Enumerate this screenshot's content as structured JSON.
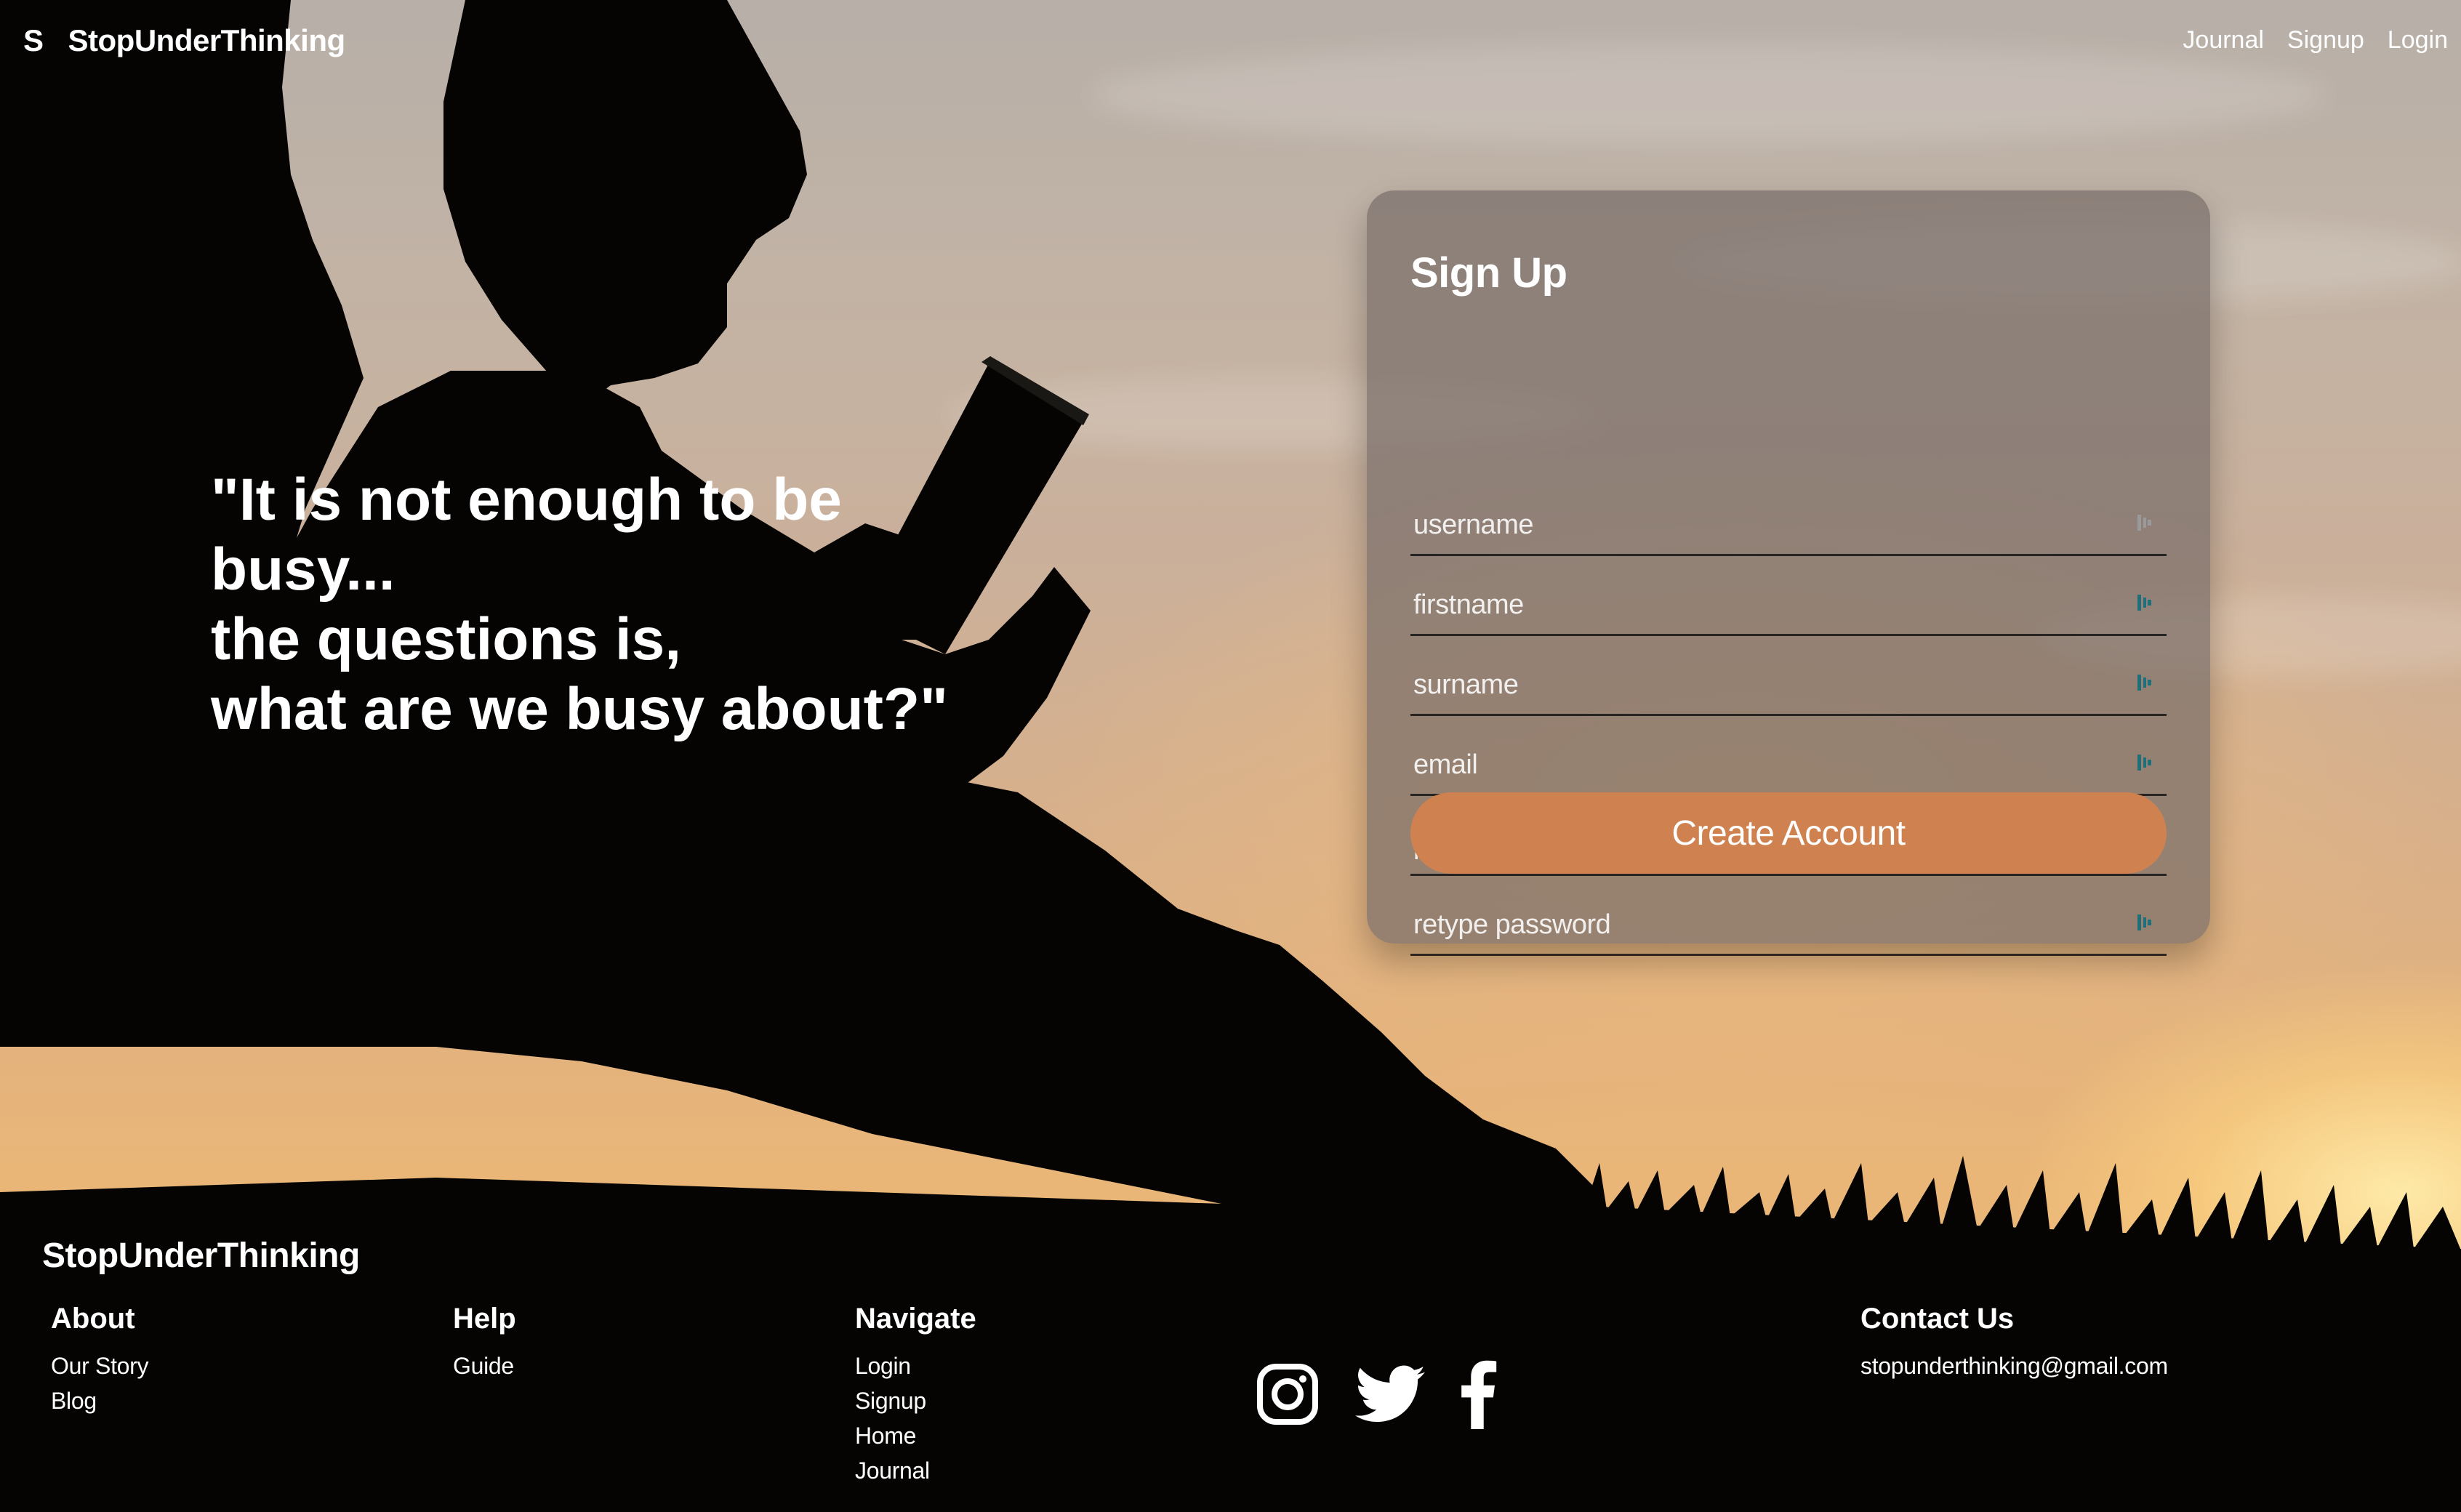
{
  "nav": {
    "logo_letter": "S",
    "brand": "StopUnderThinking",
    "links": [
      "Journal",
      "Signup",
      "Login"
    ]
  },
  "quote": {
    "lines": [
      "\"It is not enough to be",
      "busy...",
      "the questions is,",
      "what are we busy about?\""
    ]
  },
  "signup": {
    "title": "Sign Up",
    "fields": [
      {
        "placeholder": "username"
      },
      {
        "placeholder": "firstname"
      },
      {
        "placeholder": "surname"
      },
      {
        "placeholder": "email"
      },
      {
        "placeholder": "password"
      },
      {
        "placeholder": "retype password"
      }
    ],
    "submit_label": "Create Account"
  },
  "footer": {
    "brand": "StopUnderThinking",
    "about": {
      "heading": "About",
      "links": [
        "Our Story",
        "Blog"
      ]
    },
    "help": {
      "heading": "Help",
      "links": [
        "Guide"
      ]
    },
    "navigate": {
      "heading": "Navigate",
      "links": [
        "Login",
        "Signup",
        "Home",
        "Journal"
      ]
    },
    "social_icons": [
      "instagram-icon",
      "twitter-icon",
      "facebook-icon"
    ],
    "contact": {
      "heading": "Contact Us",
      "email": "stopunderthinking@gmail.com"
    }
  },
  "colors": {
    "button": "#cf8250",
    "card": "#786e69",
    "field_icon": "#1f6f7a"
  }
}
